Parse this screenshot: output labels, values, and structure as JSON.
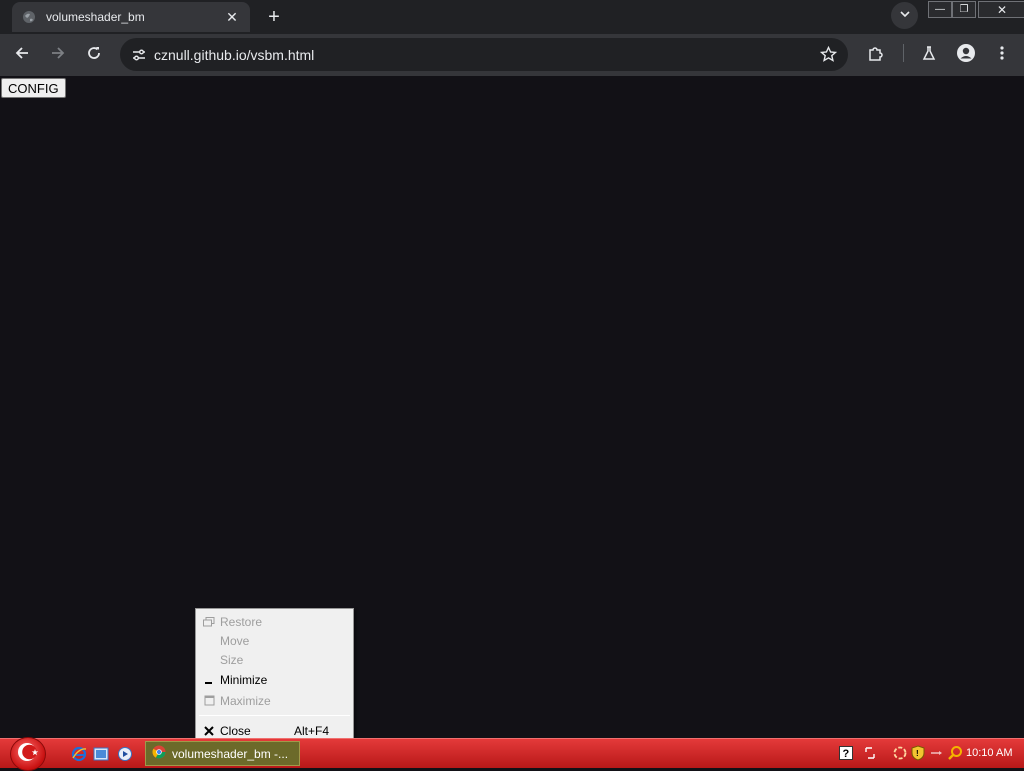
{
  "browser": {
    "tab": {
      "title": "volumeshader_bm",
      "close_glyph": "✕"
    },
    "newtab_glyph": "+",
    "window_controls": {
      "minimize": "—",
      "restore": "❐",
      "close": "✕"
    },
    "address": {
      "url": "cznull.github.io/vsbm.html"
    }
  },
  "page": {
    "config_label": "CONFIG",
    "background": "#121116"
  },
  "system_menu": {
    "items": [
      {
        "label": "Restore",
        "icon": "restore-icon",
        "enabled": false,
        "accel": ""
      },
      {
        "label": "Move",
        "icon": "",
        "enabled": false,
        "accel": ""
      },
      {
        "label": "Size",
        "icon": "",
        "enabled": false,
        "accel": ""
      },
      {
        "label": "Minimize",
        "icon": "minimize-icon",
        "enabled": true,
        "accel": ""
      },
      {
        "label": "Maximize",
        "icon": "maximize-icon",
        "enabled": false,
        "accel": ""
      },
      {
        "label": "Close",
        "icon": "close-icon",
        "enabled": true,
        "accel": "Alt+F4"
      }
    ]
  },
  "taskbar": {
    "task_item_label": "volumeshader_bm -...",
    "clock": "10:10 AM",
    "accent": "#d32626"
  }
}
